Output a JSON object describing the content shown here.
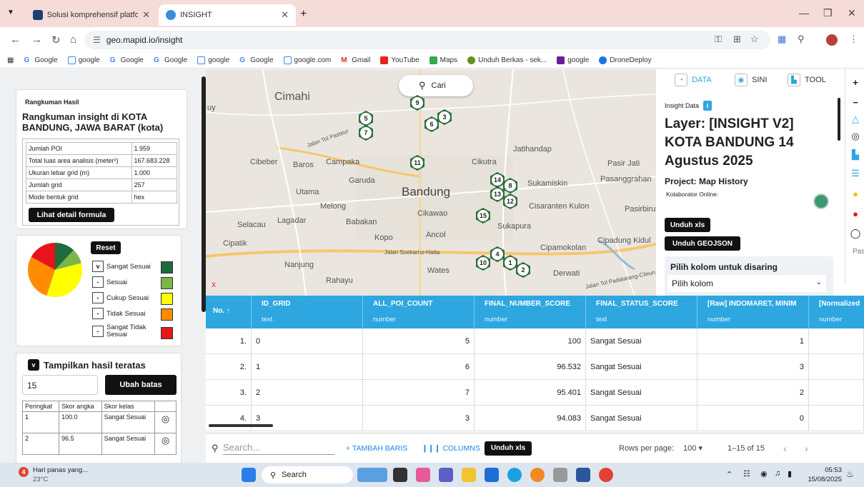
{
  "browser": {
    "tabs": [
      {
        "title": "Solusi komprehensif platform A"
      },
      {
        "title": "INSIGHT"
      }
    ],
    "url": "geo.mapid.io/insight",
    "new_tab": "+",
    "bookmarks": [
      "Google",
      "google",
      "Google",
      "Google",
      "google",
      "Google",
      "google.com",
      "Gmail",
      "YouTube",
      "Maps",
      "Unduh Berkas - sek...",
      "google",
      "DroneDeploy"
    ]
  },
  "summary": {
    "section_label": "Rangkuman Hasil",
    "heading": "Rangkuman insight di KOTA BANDUNG, JAWA BARAT (kota)",
    "rows": [
      {
        "k": "Jumlah POI",
        "v": "1.959"
      },
      {
        "k": "Total luas area analisis (meter²)",
        "v": "167.683.228"
      },
      {
        "k": "Ukuran lebar grid (m)",
        "v": "1.000"
      },
      {
        "k": "Jumlah grid",
        "v": "257"
      },
      {
        "k": "Mode bentuk grid",
        "v": "hex"
      }
    ],
    "detail_button": "Lihat detail formula"
  },
  "legend": {
    "reset": "Reset",
    "items": [
      {
        "label": "Sangat Sesuai",
        "check": "v",
        "color": "#1e6b3c"
      },
      {
        "label": "Sesuai",
        "check": "-",
        "color": "#7ab648"
      },
      {
        "label": "Cukup Sesuai",
        "check": "-",
        "color": "#ffff00"
      },
      {
        "label": "Tidak Sesuai",
        "check": "-",
        "color": "#ff8c00"
      },
      {
        "label": "Sangat Tidak Sesuai",
        "check": "-",
        "color": "#e8141c"
      }
    ],
    "pie": [
      {
        "label": "Sangat Sesuai",
        "value": 12,
        "color": "#1e6b3c"
      },
      {
        "label": "Sesuai",
        "value": 9,
        "color": "#7ab648"
      },
      {
        "label": "Cukup Sesuai",
        "value": 34,
        "color": "#ffff00"
      },
      {
        "label": "Tidak Sesuai",
        "value": 28,
        "color": "#ff8c00"
      },
      {
        "label": "Sangat Tidak Sesuai",
        "value": 17,
        "color": "#e8141c"
      }
    ]
  },
  "top_results": {
    "toggle": "v",
    "title": "Tampilkan hasil teratas",
    "input_value": "15",
    "button": "Ubah batas",
    "headers": [
      "Peringkat",
      "Skor angka",
      "Skor kelas"
    ],
    "rows": [
      {
        "rank": "1",
        "score": "100.0",
        "cls": "Sangat Sesuai"
      },
      {
        "rank": "2",
        "score": "96.5",
        "cls": "Sangat Sesuai"
      }
    ]
  },
  "map": {
    "search": "Cari",
    "close": "x",
    "labels": [
      "Cimahi",
      "Cibeber",
      "Baros",
      "Campaka",
      "Garuda",
      "Utama",
      "Melong",
      "Bandung",
      "Cikawao",
      "Babakan",
      "Lagadar",
      "Selacau",
      "Cipatik",
      "Kopo",
      "Ancol",
      "Nanjung",
      "Rahayu",
      "Wates",
      "Cikutra",
      "Jatihandap",
      "Sukamiskin",
      "Pasanggrahan",
      "Pasir Jati",
      "Cisaranten Kulon",
      "Pasirbiru",
      "Sukapura",
      "Cipamokolan",
      "Cipadung Kidul",
      "Derwati",
      "Jalan Tol Pasteur",
      "Jalan Soekarno-Hatta",
      "Jalan Tol Padalarang-Cileun",
      "uy",
      "Pas"
    ],
    "markers": [
      "9",
      "5",
      "6",
      "3",
      "7",
      "11",
      "14",
      "8",
      "13",
      "12",
      "15",
      "4",
      "10",
      "1",
      "2"
    ]
  },
  "panel": {
    "tabs": [
      "DATA",
      "SINI",
      "TOOL"
    ],
    "insight_label": "Insight Data",
    "info_icon": "i",
    "layer_title": "Layer: [INSIGHT V2] KOTA BANDUNG 14 Agustus 2025",
    "project": "Project: Map History",
    "collab": "Kolaborator Online:",
    "btn_xls": "Unduh xls",
    "btn_geojson": "Unduh GEOJSON",
    "filter_title": "Pilih kolom untuk disaring",
    "filter_placeholder": "Pilih kolom"
  },
  "grid": {
    "columns": [
      {
        "name": "No.",
        "type": ""
      },
      {
        "name": "ID_GRID",
        "type": "text"
      },
      {
        "name": "ALL_POI_COUNT",
        "type": "number"
      },
      {
        "name": "FINAL_NUMBER_SCORE",
        "type": "number"
      },
      {
        "name": "FINAL_STATUS_SCORE",
        "type": "text"
      },
      {
        "name": "[Raw] INDOMARET, MINIM",
        "type": "number"
      },
      {
        "name": "[Normalized",
        "type": "number"
      }
    ],
    "rows": [
      {
        "no": "1.",
        "id": "0",
        "poi": "5",
        "score": "100",
        "status": "Sangat Sesuai",
        "raw": "1"
      },
      {
        "no": "2.",
        "id": "1",
        "poi": "6",
        "score": "96.532",
        "status": "Sangat Sesuai",
        "raw": "3"
      },
      {
        "no": "3.",
        "id": "2",
        "poi": "7",
        "score": "95.401",
        "status": "Sangat Sesuai",
        "raw": "2"
      },
      {
        "no": "4.",
        "id": "3",
        "poi": "3",
        "score": "94.083",
        "status": "Sangat Sesuai",
        "raw": "0"
      }
    ],
    "search_placeholder": "Search...",
    "add_row": "+ TAMBAH BARIS",
    "columns_btn": "COLUMNS",
    "download": "Unduh xls",
    "rows_per_page_label": "Rows per page:",
    "rows_per_page": "100",
    "range": "1–15 of 15"
  },
  "taskbar": {
    "weather": "Hari panas yang...",
    "temp": "23°C",
    "search": "Search",
    "time": "05:53",
    "date": "15/08/2025",
    "badge": "4"
  }
}
